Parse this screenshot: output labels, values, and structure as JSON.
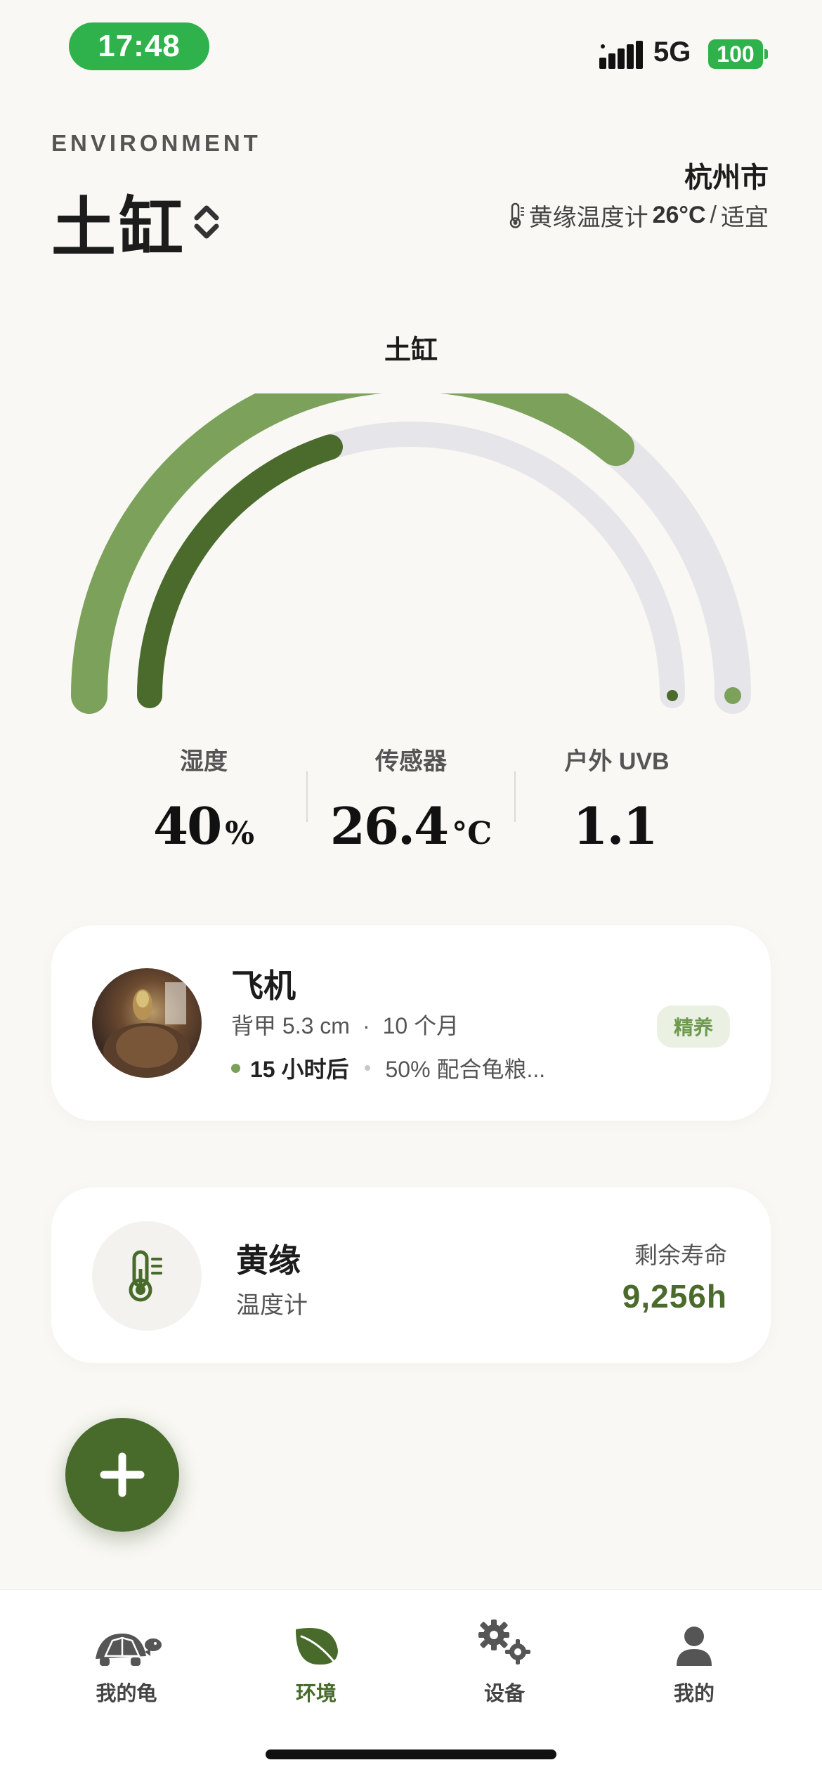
{
  "status_bar": {
    "time": "17:48",
    "network": "5G",
    "battery": "100"
  },
  "header": {
    "section_label": "ENVIRONMENT",
    "tank_name": "土缸",
    "city": "杭州市",
    "sensor_name": "黄缘温度计",
    "sensor_temp": "26°C",
    "sensor_separator": "/",
    "sensor_status": "适宜"
  },
  "gauge": {
    "title": "土缸",
    "outer_ring_level": 0.72,
    "inner_ring_level": 0.4,
    "colors": {
      "outer": "#7ca15a",
      "inner": "#4a6b2c",
      "track": "#e6e5e9"
    }
  },
  "metrics": [
    {
      "label": "湿度",
      "value": "40",
      "unit": "%"
    },
    {
      "label": "传感器",
      "value": "26.4",
      "unit": "°C"
    },
    {
      "label": "户外 UVB",
      "value": "1.1",
      "unit": ""
    }
  ],
  "turtle_card": {
    "name": "飞机",
    "shell_length": "背甲 5.3 cm",
    "separator": "·",
    "age": "10 个月",
    "next_feed": "15 小时后",
    "feed_note": "50% 配合龟粮...",
    "badge": "精养"
  },
  "device_card": {
    "icon": "thermometer-icon",
    "name": "黄缘",
    "type": "温度计",
    "life_label": "剩余寿命",
    "life_value": "9,256h"
  },
  "fab": {
    "icon": "plus-icon"
  },
  "tabs": [
    {
      "label": "我的龟",
      "icon": "turtle-icon",
      "active": false
    },
    {
      "label": "环境",
      "icon": "leaf-icon",
      "active": true
    },
    {
      "label": "设备",
      "icon": "gears-icon",
      "active": false
    },
    {
      "label": "我的",
      "icon": "person-icon",
      "active": false
    }
  ],
  "accent_color": "#486a2b"
}
